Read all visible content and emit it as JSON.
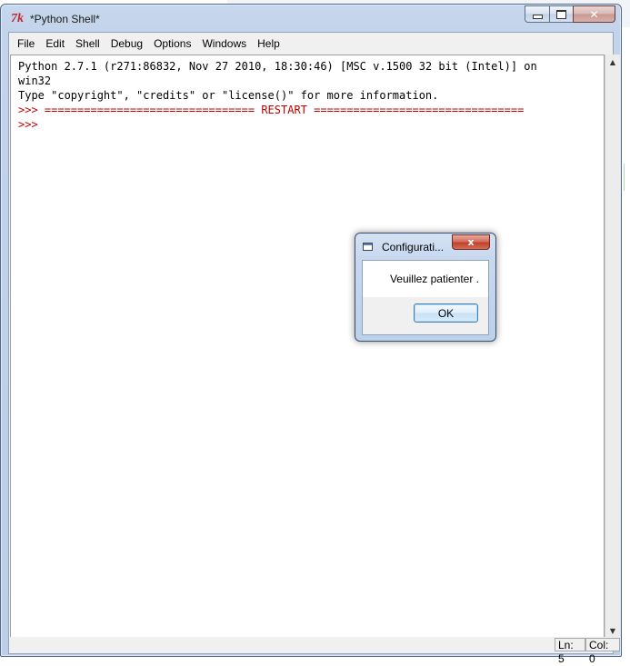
{
  "window": {
    "title": "*Python Shell*",
    "app_icon_text": "7k"
  },
  "menubar": {
    "items": [
      "File",
      "Edit",
      "Shell",
      "Debug",
      "Options",
      "Windows",
      "Help"
    ]
  },
  "shell": {
    "lines": [
      {
        "prompt": "",
        "text": "Python 2.7.1 (r271:86832, Nov 27 2010, 18:30:46) [MSC v.1500 32 bit (Intel)] on"
      },
      {
        "prompt": "",
        "text": "win32"
      },
      {
        "prompt": "",
        "text": "Type \"copyright\", \"credits\" or \"license()\" for more information."
      },
      {
        "prompt": ">>> ",
        "text": "================================ RESTART ================================"
      },
      {
        "prompt": ">>> ",
        "text": ""
      }
    ]
  },
  "statusbar": {
    "line": "Ln: 5",
    "column": "Col: 0"
  },
  "dialog": {
    "title": "Configurati...",
    "message": "Veuillez patienter .",
    "ok_label": "OK",
    "close_label": "x"
  },
  "colors": {
    "prompt": "#c00000",
    "frame": "#c7d8ee"
  }
}
